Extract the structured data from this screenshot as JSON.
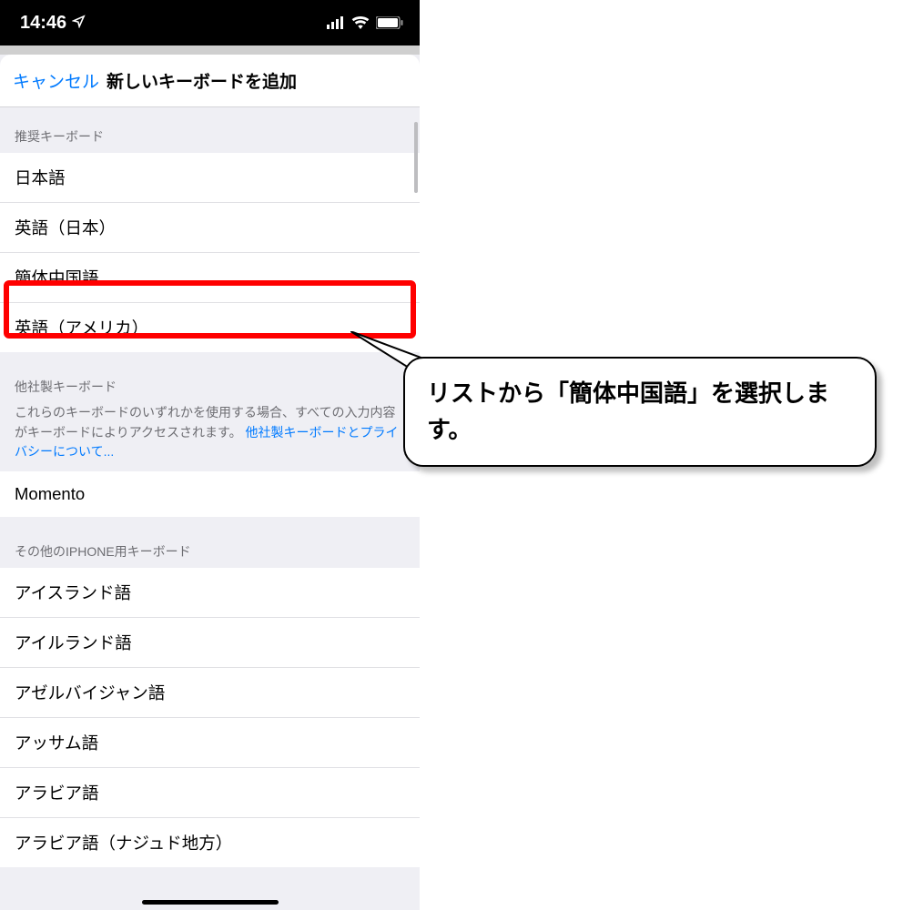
{
  "status": {
    "time": "14:46",
    "location_icon": "location-arrow",
    "signal_icon": "cellular-signal",
    "wifi_icon": "wifi",
    "battery_icon": "battery"
  },
  "nav": {
    "cancel": "キャンセル",
    "title": "新しいキーボードを追加"
  },
  "sections": {
    "recommended": {
      "header": "推奨キーボード",
      "items": [
        "日本語",
        "英語（日本）",
        "簡体中国語",
        "英語（アメリカ）"
      ]
    },
    "thirdparty": {
      "header": "他社製キーボード",
      "subtext_plain": "これらのキーボードのいずれかを使用する場合、すべての入力内容がキーボードによりアクセスされます。",
      "subtext_link": "他社製キーボードとプライバシーについて...",
      "items": [
        "Momento"
      ]
    },
    "other": {
      "header": "その他のIPHONE用キーボード",
      "items": [
        "アイスランド語",
        "アイルランド語",
        "アゼルバイジャン語",
        "アッサム語",
        "アラビア語",
        "アラビア語（ナジュド地方）"
      ]
    }
  },
  "callout": {
    "text": "リストから「簡体中国語」を選択します。"
  }
}
